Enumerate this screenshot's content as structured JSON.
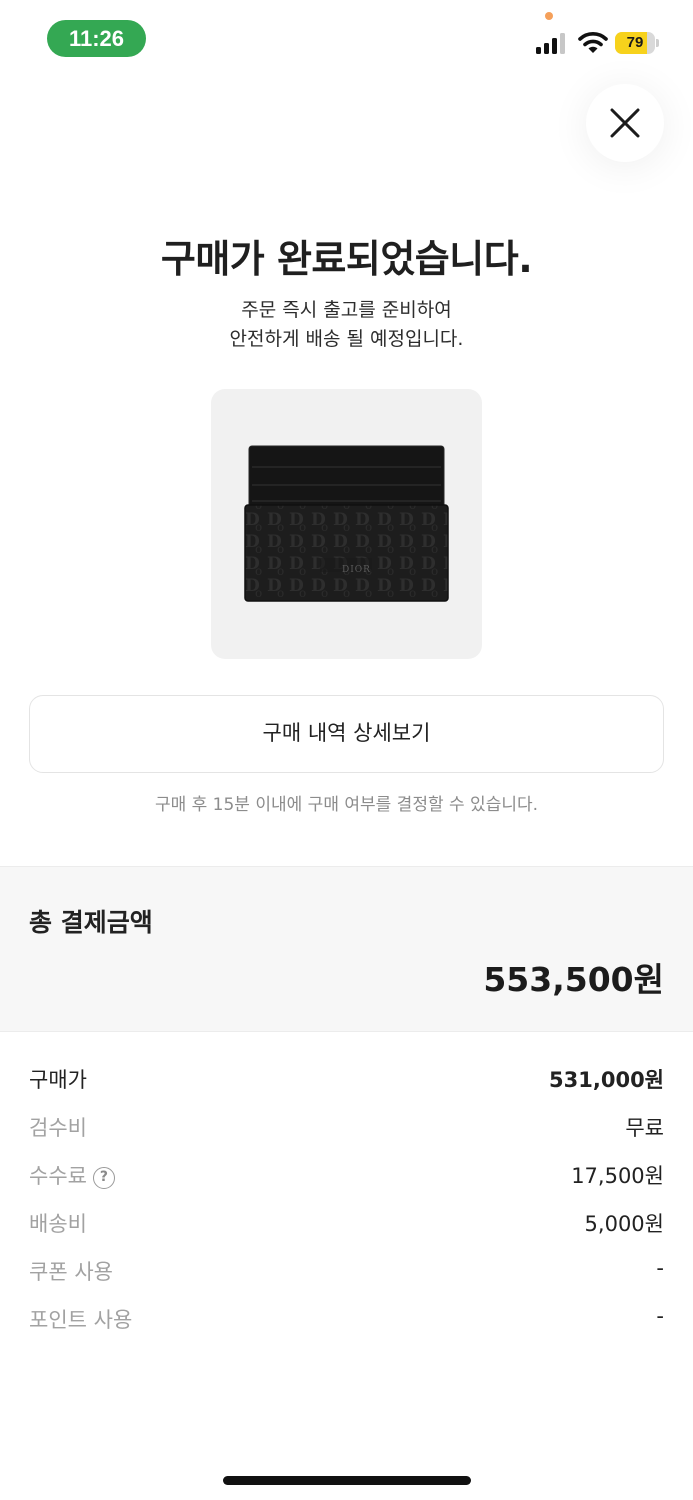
{
  "status_bar": {
    "time": "11:26",
    "battery_level": "79",
    "battery_fraction": 0.79,
    "colors": {
      "time_pill": "#34a853",
      "battery": "#f7d21c",
      "privacy_dot": "#f5a05a"
    }
  },
  "header": {
    "title": "구매가 완료되었습니다.",
    "subtitle_line1": "주문 즉시 출고를 준비하여",
    "subtitle_line2": "안전하게 배송 될 예정입니다."
  },
  "product": {
    "image_label": "DIOR"
  },
  "actions": {
    "detail_button_label": "구매 내역 상세보기",
    "notice": "구매 후 15분 이내에 구매 여부를 결정할 수 있습니다."
  },
  "total": {
    "label": "총 결제금액",
    "amount": "553,500원"
  },
  "breakdown": [
    {
      "label": "구매가",
      "value": "531,000원"
    },
    {
      "label": "검수비",
      "value": "무료"
    },
    {
      "label": "수수료",
      "value": "17,500원",
      "help": "?"
    },
    {
      "label": "배송비",
      "value": "5,000원"
    },
    {
      "label": "쿠폰 사용",
      "value": "-"
    },
    {
      "label": "포인트 사용",
      "value": "-"
    }
  ]
}
